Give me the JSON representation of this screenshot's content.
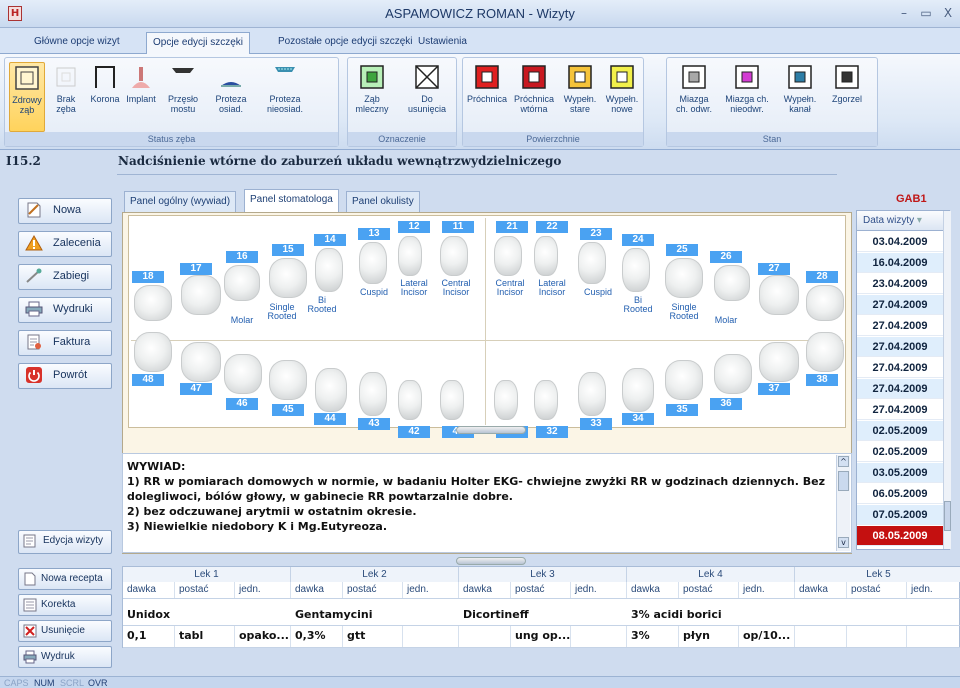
{
  "window": {
    "title": "ASPAMOWICZ ROMAN - Wizyty",
    "min": "–",
    "max": "▭",
    "close": "X"
  },
  "ribbon_tabs": [
    "Główne opcje wizyt",
    "Opcje edycji szczęki",
    "Pozostałe opcje edycji szczęki",
    "Ustawienia"
  ],
  "groups": {
    "status": {
      "label": "Status zęba",
      "items": [
        "Zdrowy\nząb",
        "Brak\nzęba",
        "Korona",
        "Implant",
        "Przęsło\nmostu",
        "Proteza\nosiad.",
        "Proteza\nnieosiad."
      ]
    },
    "oznaczenie": {
      "label": "Oznaczenie",
      "items": [
        "Ząb\nmleczny",
        "Do\nusunięcia"
      ]
    },
    "powierzchnie": {
      "label": "Powierzchnie",
      "items": [
        "Próchnica",
        "Próchnica\nwtórna",
        "Wypełn.\nstare",
        "Wypełn.\nnowe"
      ]
    },
    "stan": {
      "label": "Stan",
      "items": [
        "Miazga\nch. odwr.",
        "Miazga ch.\nnieodwr.",
        "Wypełn.\nkanał",
        "Zgorzel"
      ]
    }
  },
  "diagnosis": {
    "code": "I15.2",
    "text": "Nadciśnienie wtórne do zaburzeń układu wewnątrzwydzielniczego"
  },
  "left_buttons": [
    "Nowa",
    "Zalecenia",
    "Zabiegi",
    "Wydruki",
    "Faktura",
    "Powrót"
  ],
  "edit_visit": "Edycja wizyty",
  "bottom_buttons": [
    "Nowa recepta",
    "Korekta",
    "Usunięcie",
    "Wydruk"
  ],
  "panel_tabs": [
    "Panel ogólny (wywiad)",
    "Panel stomatologa",
    "Panel okulisty"
  ],
  "upper_numbers": [
    "18",
    "17",
    "16",
    "15",
    "14",
    "13",
    "12",
    "11",
    "21",
    "22",
    "23",
    "24",
    "25",
    "26",
    "27",
    "28"
  ],
  "lower_numbers": [
    "48",
    "47",
    "46",
    "45",
    "44",
    "43",
    "42",
    "41",
    "31",
    "32",
    "33",
    "34",
    "35",
    "36",
    "37",
    "38"
  ],
  "tooth_labels": {
    "molar": "Molar",
    "single_rooted": "Single\nRooted",
    "bi_rooted": "Bi\nRooted",
    "cuspid": "Cuspid",
    "lateral": "Lateral\nIncisor",
    "central": "Central\nIncisor"
  },
  "wywiad": {
    "header": "WYWIAD:",
    "lines": [
      "1) RR w pomiarach domowych w normie, w badaniu Holter EKG- chwiejne zwyżki RR w godzinach dziennych. Bez dolegliwoci, bólów głowy, w gabinecie RR powtarzalnie dobre.",
      "2) bez odczuwanej arytmii w ostatnim okresie.",
      "3) Niewielkie niedobory K i Mg.Eutyreoza."
    ]
  },
  "gab": "GAB1",
  "dates": {
    "header": "Data wizyty",
    "items": [
      "03.04.2009",
      "16.04.2009",
      "23.04.2009",
      "27.04.2009",
      "27.04.2009",
      "27.04.2009",
      "27.04.2009",
      "27.04.2009",
      "27.04.2009",
      "02.05.2009",
      "02.05.2009",
      "03.05.2009",
      "06.05.2009",
      "07.05.2009",
      "08.05.2009"
    ],
    "selected": 14
  },
  "meds": {
    "headers": [
      "Lek 1",
      "Lek 2",
      "Lek 3",
      "Lek 4",
      "Lek 5"
    ],
    "sub": [
      "dawka",
      "postać",
      "jedn."
    ],
    "names": [
      "Unidox",
      "Gentamycini",
      "Dicortineff",
      "3% acidi borici",
      ""
    ],
    "values": [
      [
        "0,1",
        "tabl",
        "opako..."
      ],
      [
        "0,3%",
        "gtt",
        ""
      ],
      [
        "",
        "ung op...",
        ""
      ],
      [
        "3%",
        "płyn",
        "op/10..."
      ],
      [
        "",
        "",
        ""
      ]
    ]
  },
  "statusbar": [
    "CAPS",
    "NUM",
    "SCRL",
    "OVR"
  ],
  "colors": {
    "accent": "#4aa2f2",
    "selected_date": "#c41010",
    "brand": "#1e3967"
  }
}
